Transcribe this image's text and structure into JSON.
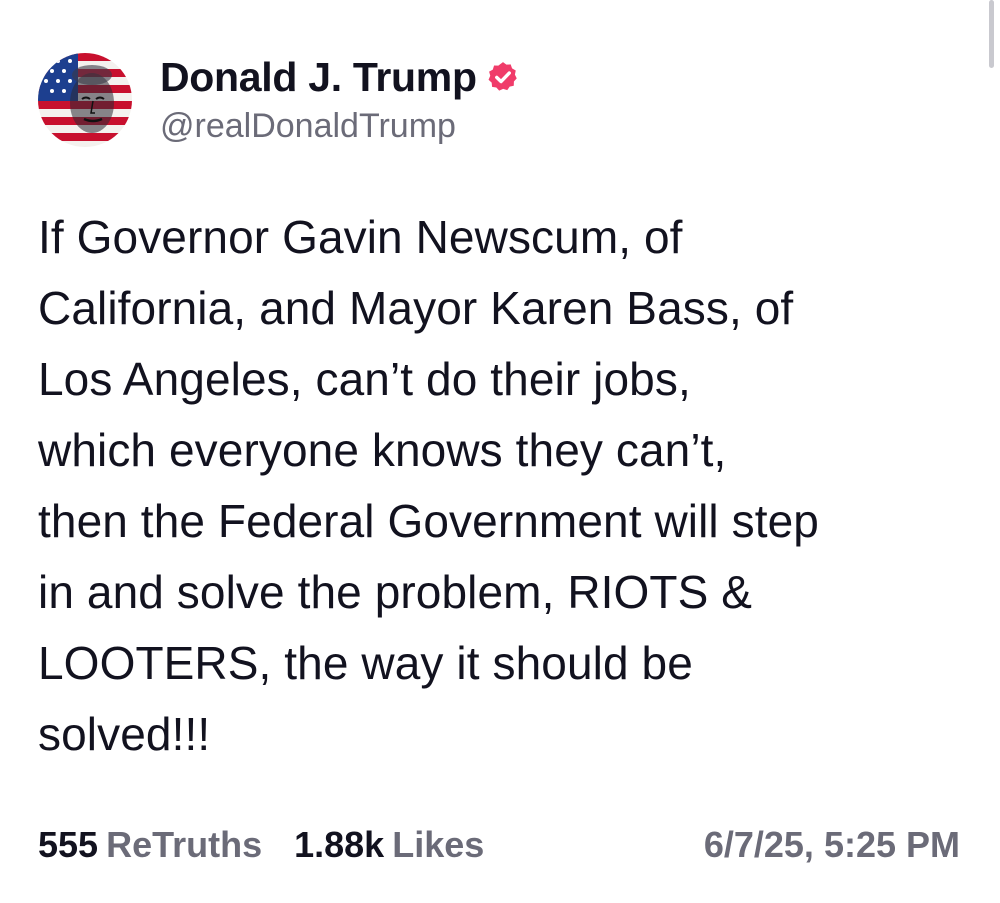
{
  "author": {
    "display_name": "Donald J. Trump",
    "handle": "@realDonaldTrump",
    "avatar_icon": "flag-portrait-avatar",
    "verified_icon": "verified-badge-icon"
  },
  "post": {
    "text": "If Governor Gavin Newscum, of\nCalifornia, and Mayor Karen Bass, of\nLos Angeles, can’t do their jobs,\nwhich everyone knows they can’t,\nthen the Federal Government will step\nin and solve the problem, RIOTS &\nLOOTERS, the way it should be\nsolved!!!"
  },
  "stats": {
    "retruths_count": "555",
    "retruths_label": "ReTruths",
    "likes_count": "1.88k",
    "likes_label": "Likes",
    "timestamp": "6/7/25, 5:25 PM"
  },
  "colors": {
    "text_primary": "#12121f",
    "text_secondary": "#6b6b78",
    "verified_badge": "#f03c6a",
    "background": "#ffffff"
  }
}
